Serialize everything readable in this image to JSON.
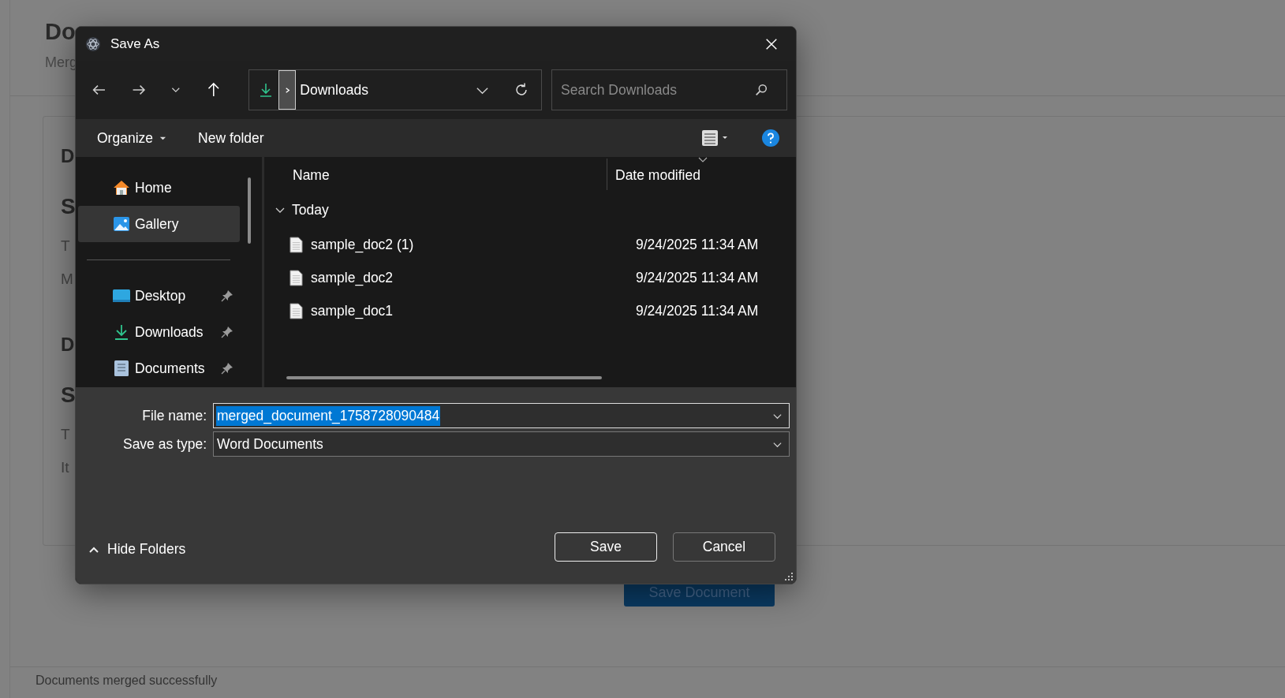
{
  "background_page": {
    "heading": "Do",
    "subtitle": "Merg",
    "card_lines": [
      {
        "kind": "h2",
        "text": "D"
      },
      {
        "kind": "h1",
        "text": "S"
      },
      {
        "kind": "p",
        "text": "T"
      },
      {
        "kind": "p",
        "text": "M"
      },
      {
        "kind": "h2",
        "text": "D"
      },
      {
        "kind": "h1",
        "text": "S"
      },
      {
        "kind": "p",
        "text": "T"
      },
      {
        "kind": "p",
        "text": "It"
      }
    ],
    "save_button": "Save Document",
    "status": "Documents merged successfully"
  },
  "dialog": {
    "title": "Save As",
    "address": {
      "location": "Downloads"
    },
    "search": {
      "placeholder": "Search Downloads"
    },
    "toolbar": {
      "organize": "Organize",
      "new_folder": "New folder"
    },
    "nav_groups": [
      [
        {
          "label": "Home",
          "selected": false,
          "pinned": false
        },
        {
          "label": "Gallery",
          "selected": true,
          "pinned": false
        }
      ],
      [
        {
          "label": "Desktop",
          "selected": false,
          "pinned": true
        },
        {
          "label": "Downloads",
          "selected": false,
          "pinned": true
        },
        {
          "label": "Documents",
          "selected": false,
          "pinned": true
        }
      ]
    ],
    "columns": [
      "Name",
      "Date modified"
    ],
    "groups": [
      {
        "label": "Today",
        "expanded": true,
        "files": [
          {
            "name": "sample_doc2 (1)",
            "date": "9/24/2025 11:34 AM"
          },
          {
            "name": "sample_doc2",
            "date": "9/24/2025 11:34 AM"
          },
          {
            "name": "sample_doc1",
            "date": "9/24/2025 11:34 AM"
          }
        ]
      }
    ],
    "file_name": {
      "label": "File name:",
      "value": "merged_document_1758728090484",
      "selected": true
    },
    "save_type": {
      "label": "Save as type:",
      "value": "Word Documents"
    },
    "hide_folders": "Hide Folders",
    "buttons": [
      {
        "label": "Save",
        "kind": "primary"
      },
      {
        "label": "Cancel",
        "kind": "secondary"
      }
    ]
  }
}
